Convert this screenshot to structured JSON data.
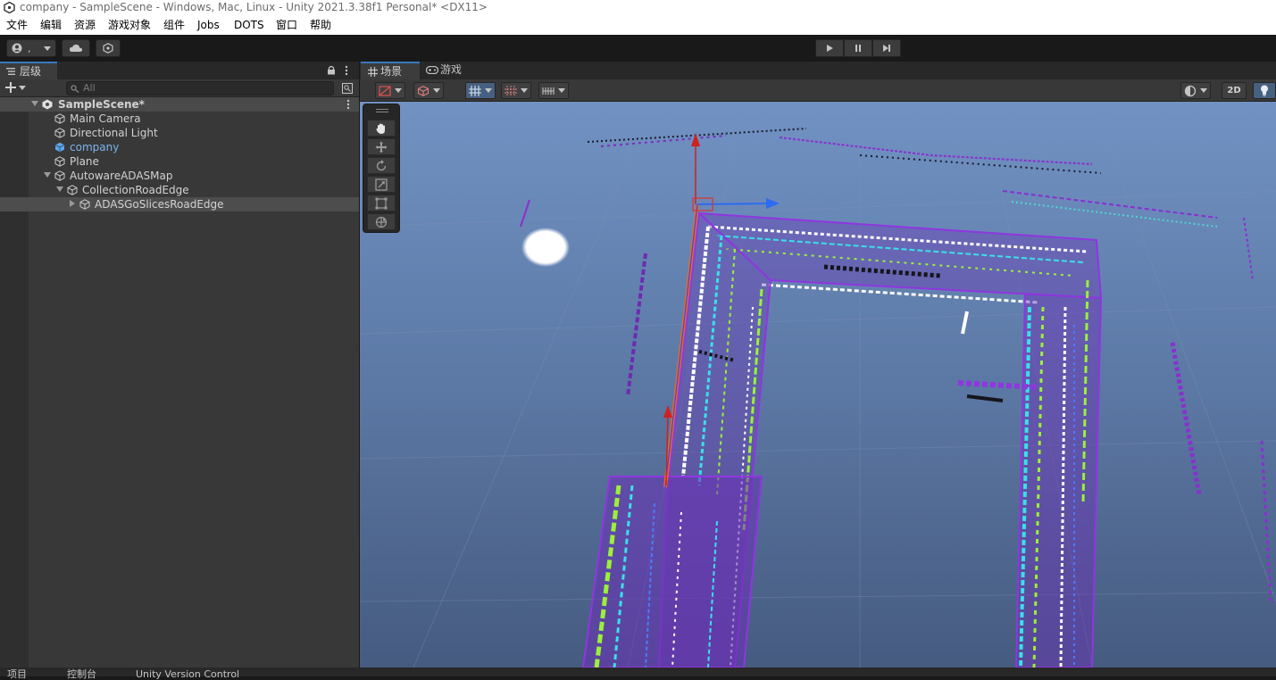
{
  "window": {
    "title": "company - SampleScene - Windows, Mac, Linux - Unity 2021.3.38f1 Personal* <DX11>"
  },
  "menu": [
    "文件",
    "编辑",
    "资源",
    "游戏对象",
    "组件",
    "Jobs",
    "DOTS",
    "窗口",
    "帮助"
  ],
  "toolbar": {
    "account_label": ",",
    "play_icon": "play-icon",
    "pause_icon": "pause-icon",
    "step_icon": "step-icon"
  },
  "hierarchy": {
    "tab_label": "层级",
    "search_placeholder": "All",
    "scene": "SampleScene*",
    "items": [
      {
        "label": "Main Camera",
        "depth": 1
      },
      {
        "label": "Directional Light",
        "depth": 1
      },
      {
        "label": "company",
        "depth": 1,
        "highlight": true
      },
      {
        "label": "Plane",
        "depth": 1
      },
      {
        "label": "AutowareADASMap",
        "depth": 1
      },
      {
        "label": "CollectionRoadEdge",
        "depth": 2
      },
      {
        "label": "ADASGoSlicesRoadEdge",
        "depth": 3
      }
    ]
  },
  "scene_view": {
    "tabs": [
      {
        "label": "场景",
        "active": true
      },
      {
        "label": "游戏",
        "active": false
      }
    ],
    "toggle_2d": "2D",
    "colors": {
      "sky": "#6f8fbd",
      "ground": "#4a5f85",
      "accent": "#3a79bb"
    }
  },
  "bottom": {
    "tabs": [
      "项目",
      "控制台",
      "Unity Version Control"
    ]
  }
}
